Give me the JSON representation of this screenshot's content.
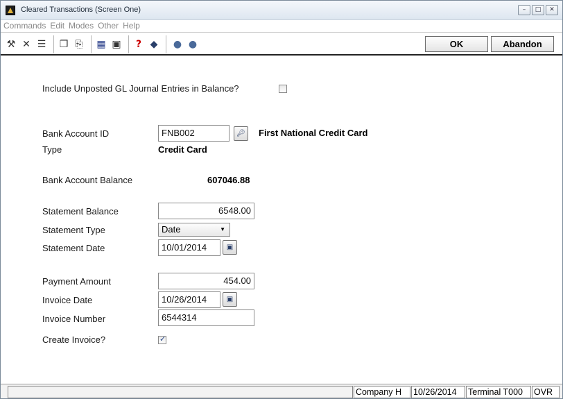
{
  "window": {
    "title": "Cleared Transactions (Screen One)",
    "controls": {
      "minimize": "–",
      "maximize": "□",
      "close": "✕"
    }
  },
  "menu": [
    "Commands",
    "Edit",
    "Modes",
    "Other",
    "Help"
  ],
  "toolbar": {
    "icons": {
      "tools": "⚒",
      "delete": "✕",
      "list": "☰",
      "copy": "❐",
      "paste": "⎘",
      "calculator": "▦",
      "calendar": "▣",
      "help": "?",
      "book": "◆",
      "back": "●",
      "forward": "●"
    },
    "ok_label": "OK",
    "abandon_label": "Abandon"
  },
  "form": {
    "include_unposted_label": "Include Unposted GL Journal Entries in Balance?",
    "include_unposted_checked": false,
    "bank_account_id_label": "Bank Account ID",
    "bank_account_id_value": "FNB002",
    "bank_account_name": "First National Credit Card",
    "type_label": "Type",
    "type_value": "Credit Card",
    "balance_label": "Bank Account Balance",
    "balance_value": "607046.88",
    "statement_balance_label": "Statement Balance",
    "statement_balance_value": "6548.00",
    "statement_type_label": "Statement Type",
    "statement_type_value": "Date",
    "statement_date_label": "Statement Date",
    "statement_date_value": "10/01/2014",
    "payment_amount_label": "Payment Amount",
    "payment_amount_value": "454.00",
    "invoice_date_label": "Invoice Date",
    "invoice_date_value": "10/26/2014",
    "invoice_number_label": "Invoice Number",
    "invoice_number_value": "6544314",
    "create_invoice_label": "Create Invoice?",
    "create_invoice_checked": true
  },
  "status": {
    "company": "Company H",
    "date": "10/26/2014",
    "terminal": "Terminal T000",
    "mode": "OVR"
  },
  "colors": {
    "app_icon": "#e0b23c",
    "link_icon": "#2a3f6a"
  }
}
